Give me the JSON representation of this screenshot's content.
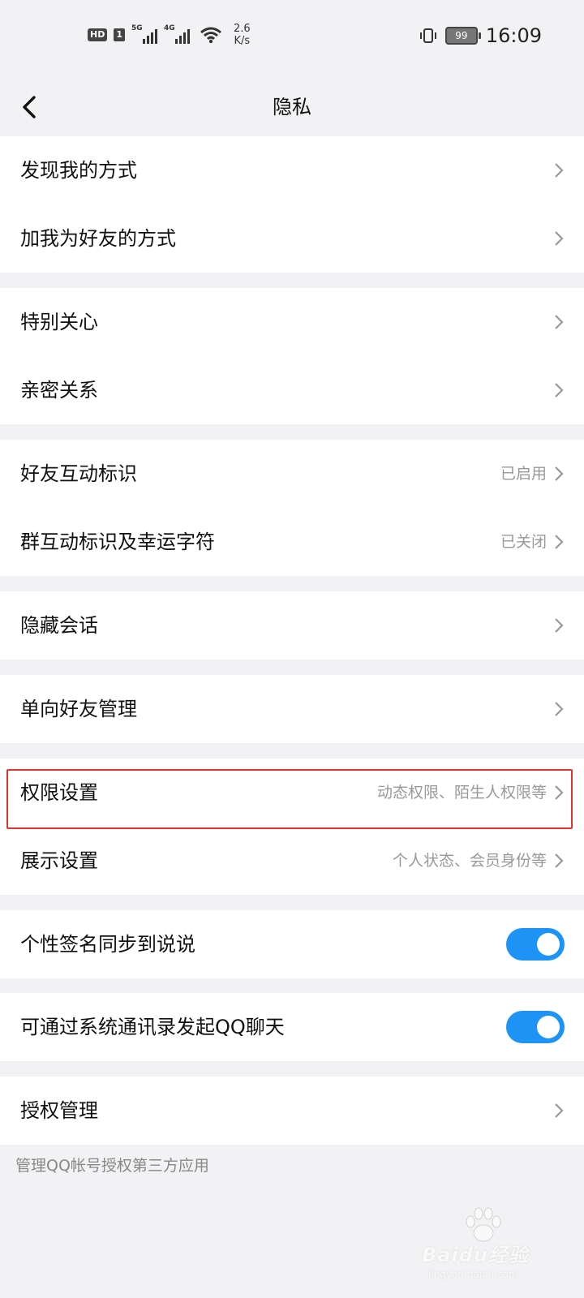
{
  "status_bar": {
    "hd": "HD",
    "sim": "1",
    "net1": "5G",
    "net2": "4G",
    "speed_value": "2.6",
    "speed_unit": "K/s",
    "battery": "99",
    "time": "16:09"
  },
  "nav": {
    "title": "隐私",
    "back_icon": "back-chevron-icon"
  },
  "groups": [
    {
      "rows": [
        {
          "label": "发现我的方式"
        },
        {
          "label": "加我为好友的方式"
        }
      ]
    },
    {
      "rows": [
        {
          "label": "特别关心"
        },
        {
          "label": "亲密关系"
        }
      ]
    },
    {
      "rows": [
        {
          "label": "好友互动标识",
          "value": "已启用"
        },
        {
          "label": "群互动标识及幸运字符",
          "value": "已关闭"
        }
      ]
    },
    {
      "rows": [
        {
          "label": "隐藏会话"
        }
      ]
    },
    {
      "rows": [
        {
          "label": "单向好友管理"
        }
      ]
    },
    {
      "rows": [
        {
          "label": "权限设置",
          "value": "动态权限、陌生人权限等"
        },
        {
          "label": "展示设置",
          "value": "个人状态、会员身份等"
        }
      ]
    },
    {
      "rows": [
        {
          "label": "个性签名同步到说说",
          "toggle": true
        }
      ]
    },
    {
      "rows": [
        {
          "label": "可通过系统通讯录发起QQ聊天",
          "toggle": true
        }
      ]
    },
    {
      "rows": [
        {
          "label": "授权管理"
        }
      ]
    }
  ],
  "footer_note": "管理QQ帐号授权第三方应用",
  "watermark": {
    "text": "Baidu经验",
    "sub": "jingyan.baidu.com"
  },
  "colors": {
    "accent": "#1d94f5",
    "highlight": "#e0352f",
    "background": "#f2f2f4"
  }
}
